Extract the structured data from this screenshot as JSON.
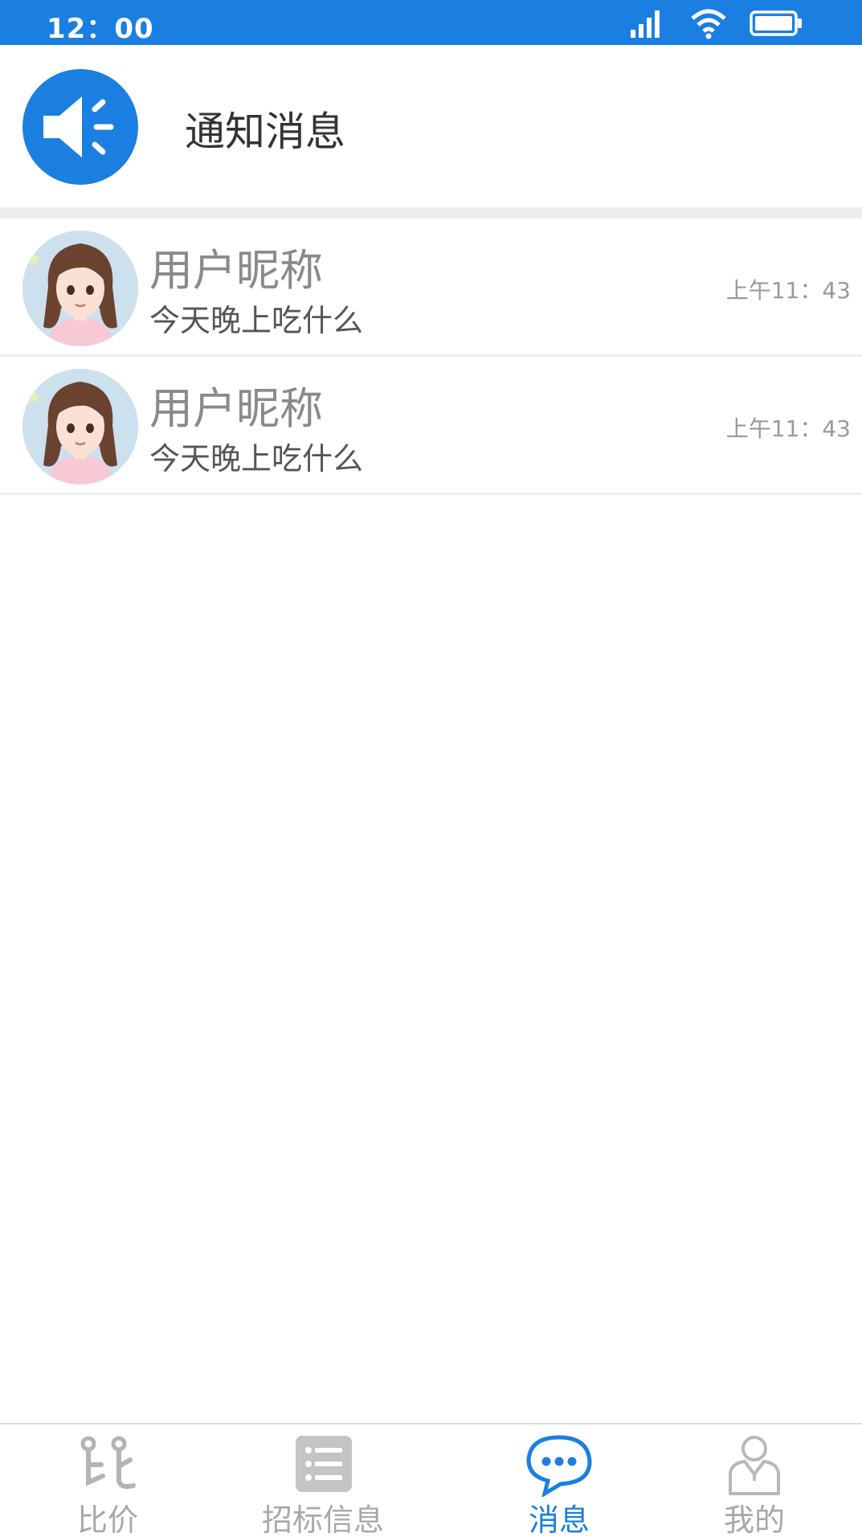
{
  "status_bar": {
    "time": "12：00",
    "icons": [
      "signal-icon",
      "wifi-icon",
      "battery-icon"
    ],
    "color": "#1a7fe0"
  },
  "notice": {
    "title": "通知消息",
    "icon": "speaker-icon"
  },
  "messages": [
    {
      "name": "用户昵称",
      "preview": "今天晚上吃什么",
      "time": "上午11：43"
    },
    {
      "name": "用户昵称",
      "preview": "今天晚上吃什么",
      "time": "上午11：43"
    }
  ],
  "tabs": [
    {
      "label": "比价",
      "icon": "compare-price-icon",
      "active": false
    },
    {
      "label": "招标信息",
      "icon": "list-icon",
      "active": false
    },
    {
      "label": "消息",
      "icon": "chat-bubble-icon",
      "active": true
    },
    {
      "label": "我的",
      "icon": "user-icon",
      "active": false
    }
  ],
  "colors": {
    "accent": "#1a7fe0",
    "inactive": "#a8a8a8"
  }
}
